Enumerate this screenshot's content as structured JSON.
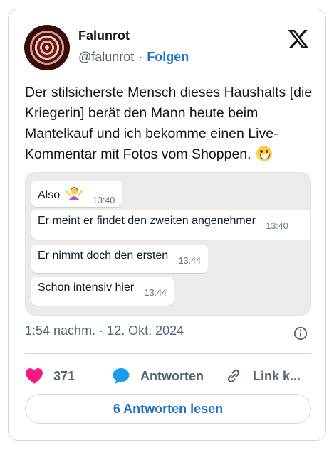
{
  "author": {
    "name": "Falunrot",
    "handle": "@falunrot",
    "separator": "·",
    "follow_label": "Folgen"
  },
  "tweet": {
    "text": "Der stilsicherste Mensch dieses Haushalts [die Kriegerin] berät den Mann heute beim Mantelkauf und ich bekomme einen Live-Kommentar mit Fotos vom Shoppen.",
    "emoji": "grinning-face-icon"
  },
  "chat_image": {
    "messages": [
      {
        "text": "Also",
        "time": "13:40",
        "emoji": "person-shrugging-icon"
      },
      {
        "text": "Er meint er findet den zweiten angenehmer",
        "time": "13:40"
      },
      {
        "text": "Er nimmt doch den ersten",
        "time": "13:44"
      },
      {
        "text": "Schon intensiv hier",
        "time": "13:44"
      }
    ]
  },
  "meta": {
    "timestamp": "1:54 nachm. · 12. Okt. 2024"
  },
  "actions": {
    "like_count": "371",
    "reply_label": "Antworten",
    "link_label": "Link k..."
  },
  "read_replies_label": "6 Antworten lesen",
  "colors": {
    "accent": "#1d73c7",
    "like": "#f91880",
    "reply_icon": "#1d9bf0",
    "muted": "#536471",
    "chat_background": "#ecebe9"
  }
}
